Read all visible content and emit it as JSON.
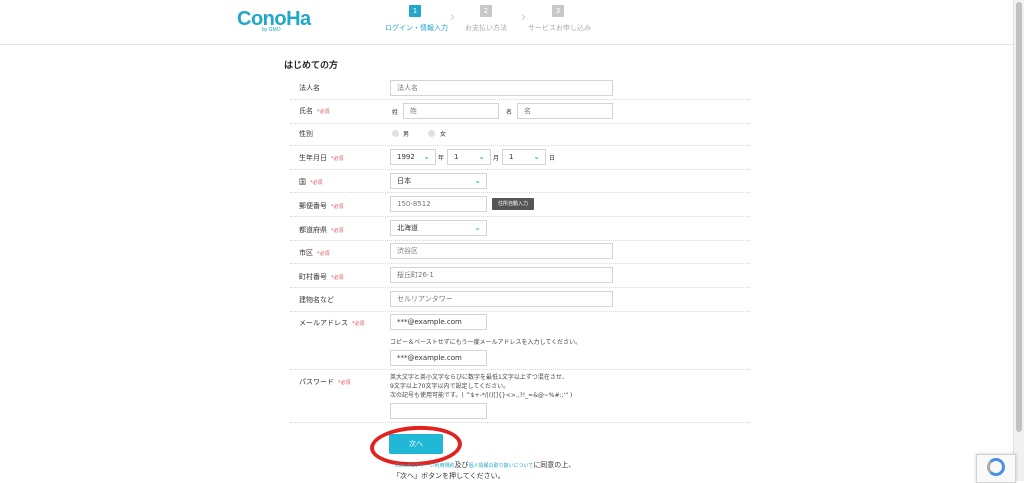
{
  "header": {
    "logo": "ConoHa",
    "logo_sub": "by GMO",
    "steps": [
      {
        "num": "1",
        "label": "ログイン・情報入力"
      },
      {
        "num": "2",
        "label": "お支払い方法"
      },
      {
        "num": "3",
        "label": "サービスお申し込み"
      }
    ],
    "chevron": "›"
  },
  "form": {
    "title": "はじめての方",
    "required": "*必須",
    "corp": {
      "label": "法人名",
      "placeholder": "法人名"
    },
    "name": {
      "label": "氏名",
      "sei_label": "姓",
      "sei_placeholder": "姓",
      "mei_label": "名",
      "mei_placeholder": "名"
    },
    "gender": {
      "label": "性別",
      "male": "男",
      "female": "女"
    },
    "birth": {
      "label": "生年月日",
      "year": "1992",
      "year_unit": "年",
      "month": "1",
      "month_unit": "月",
      "day": "1",
      "day_unit": "日"
    },
    "country": {
      "label": "国",
      "value": "日本"
    },
    "postal": {
      "label": "郵便番号",
      "placeholder": "150-8512",
      "button": "住所自動入力"
    },
    "pref": {
      "label": "都道府県",
      "value": "北海道"
    },
    "city": {
      "label": "市区",
      "placeholder": "渋谷区"
    },
    "town": {
      "label": "町村番号",
      "placeholder": "桜丘町26-1"
    },
    "building": {
      "label": "建物名など",
      "placeholder": "セルリアンタワー"
    },
    "email": {
      "label": "メールアドレス",
      "placeholder": "***@example.com",
      "confirm_note": "コピー＆ペーストせずにもう一度メールアドレスを入力してください。",
      "confirm_placeholder": "***@example.com"
    },
    "password": {
      "label": "パスワード",
      "note1": "英大文字と英小文字ならびに数字を最低1文字以上ずつ混在させ、",
      "note2": "9文字以上70文字以内で設定してください。",
      "note3": "次の記号も使用可能です。( ^$+-*/|()[]{}<>.,?!_=&@~%#:;'\" )"
    }
  },
  "next_button": "次へ",
  "consent": {
    "link1": "ConoHaチャージ利用規約",
    "and": "及び",
    "link2": "個人情報の取り扱いについて",
    "tail": "に同意の上、",
    "line2": "「次へ」ボタンを押してください。"
  },
  "icons": {
    "chevron_down": "⌄",
    "recaptcha": "recaptcha-icon"
  },
  "colors": {
    "accent": "#21a7c9",
    "required": "#e0525a",
    "circle": "#e1221f"
  }
}
